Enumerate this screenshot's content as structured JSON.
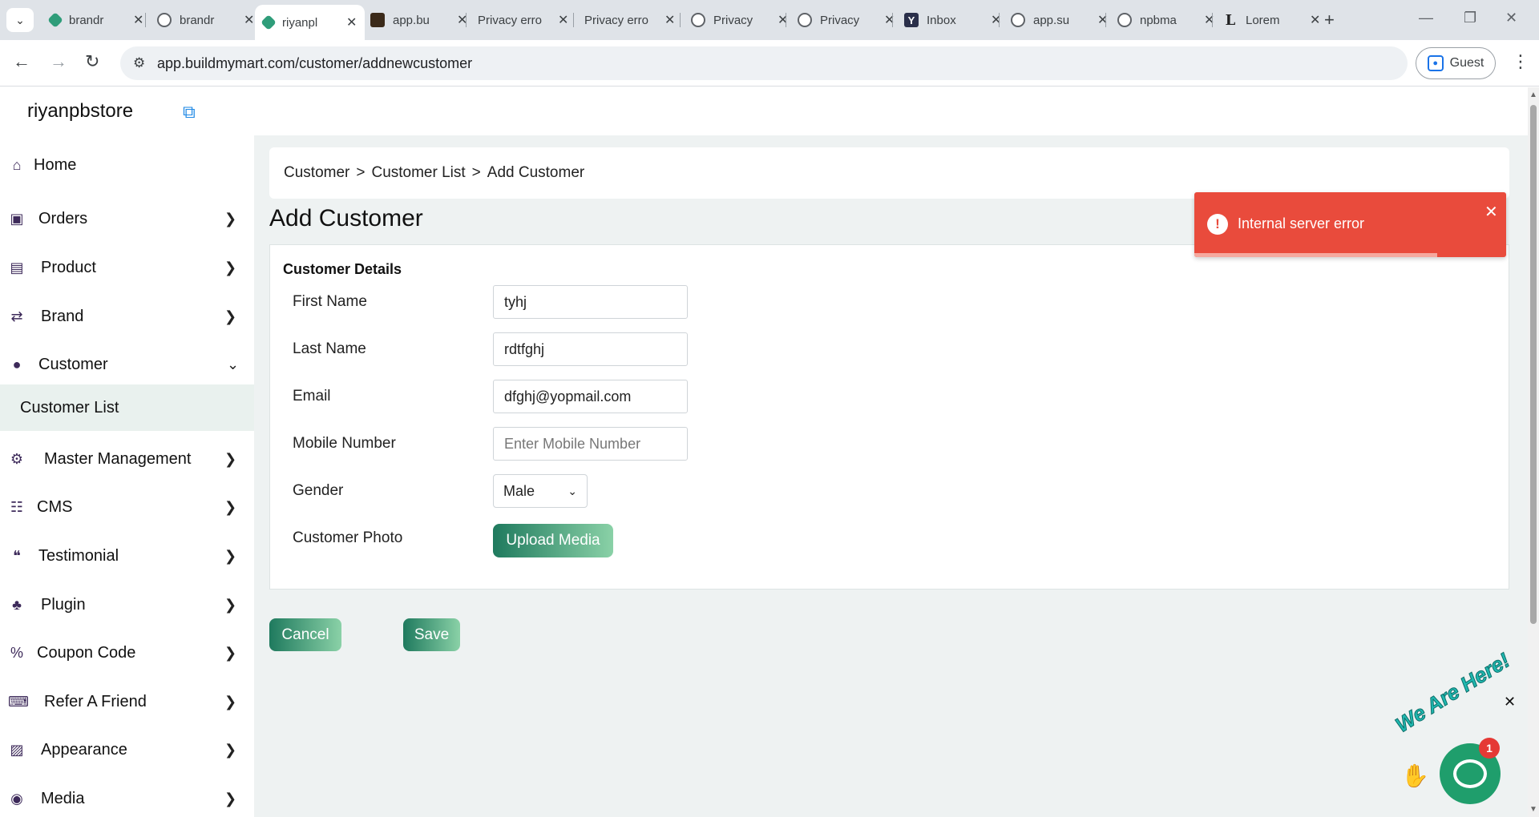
{
  "browser": {
    "tabs": [
      {
        "title": "brandr",
        "favicon": "gem-icon"
      },
      {
        "title": "brandr",
        "favicon": "globe-icon"
      },
      {
        "title": "riyanpl",
        "favicon": "gem-icon",
        "active": true
      },
      {
        "title": "app.bu",
        "favicon": "image-icon"
      },
      {
        "title": "Privacy erro",
        "favicon": "none"
      },
      {
        "title": "Privacy erro",
        "favicon": "none"
      },
      {
        "title": "Privacy",
        "favicon": "globe-icon"
      },
      {
        "title": "Privacy",
        "favicon": "globe-icon"
      },
      {
        "title": "Inbox",
        "favicon": "yahoo-icon"
      },
      {
        "title": "app.su",
        "favicon": "globe-icon"
      },
      {
        "title": "npbma",
        "favicon": "globe-icon"
      },
      {
        "title": "Lorem",
        "favicon": "lorem-icon"
      }
    ],
    "url": "app.buildmymart.com/customer/addnewcustomer",
    "profile_label": "Guest"
  },
  "app": {
    "store_name": "riyanpbstore",
    "sidebar": [
      {
        "label": "Home",
        "icon": "home-icon"
      },
      {
        "label": "Orders",
        "icon": "shopping-bag-icon"
      },
      {
        "label": "Product",
        "icon": "archive-icon"
      },
      {
        "label": "Brand",
        "icon": "shuffle-icon"
      },
      {
        "label": "Customer",
        "icon": "user-icon"
      },
      {
        "label": "Customer List"
      },
      {
        "label": "Master Management",
        "icon": "user-cog-icon"
      },
      {
        "label": "CMS",
        "icon": "file-icon"
      },
      {
        "label": "Testimonial",
        "icon": "quote-icon"
      },
      {
        "label": "Plugin",
        "icon": "puzzle-icon"
      },
      {
        "label": "Coupon Code",
        "icon": "percent-icon"
      },
      {
        "label": "Refer A Friend",
        "icon": "keyboard-icon"
      },
      {
        "label": "Appearance",
        "icon": "image-icon"
      },
      {
        "label": "Media",
        "icon": "play-circle-icon"
      }
    ],
    "breadcrumb": [
      "Customer",
      "Customer List",
      "Add Customer"
    ],
    "breadcrumb_sep": ">",
    "page_title": "Add Customer",
    "form": {
      "section_title": "Customer Details",
      "first_name": {
        "label": "First Name",
        "value": "tyhj"
      },
      "last_name": {
        "label": "Last Name",
        "value": "rdtfghj"
      },
      "email": {
        "label": "Email",
        "value": "dfghj@yopmail.com"
      },
      "mobile": {
        "label": "Mobile Number",
        "placeholder": "Enter Mobile Number"
      },
      "gender": {
        "label": "Gender",
        "value": "Male"
      },
      "photo": {
        "label": "Customer Photo",
        "button": "Upload Media"
      }
    },
    "actions": {
      "cancel": "Cancel",
      "save": "Save"
    },
    "toast": {
      "message": "Internal server error",
      "progress": 0.78
    },
    "chat": {
      "tagline": "We Are Here!",
      "badge": "1"
    }
  },
  "colors": {
    "accent_dark": "#1f7a5e",
    "accent_light": "#8ad1a7",
    "toast_red": "#e94b3c",
    "chat_green": "#1f9e6c"
  }
}
